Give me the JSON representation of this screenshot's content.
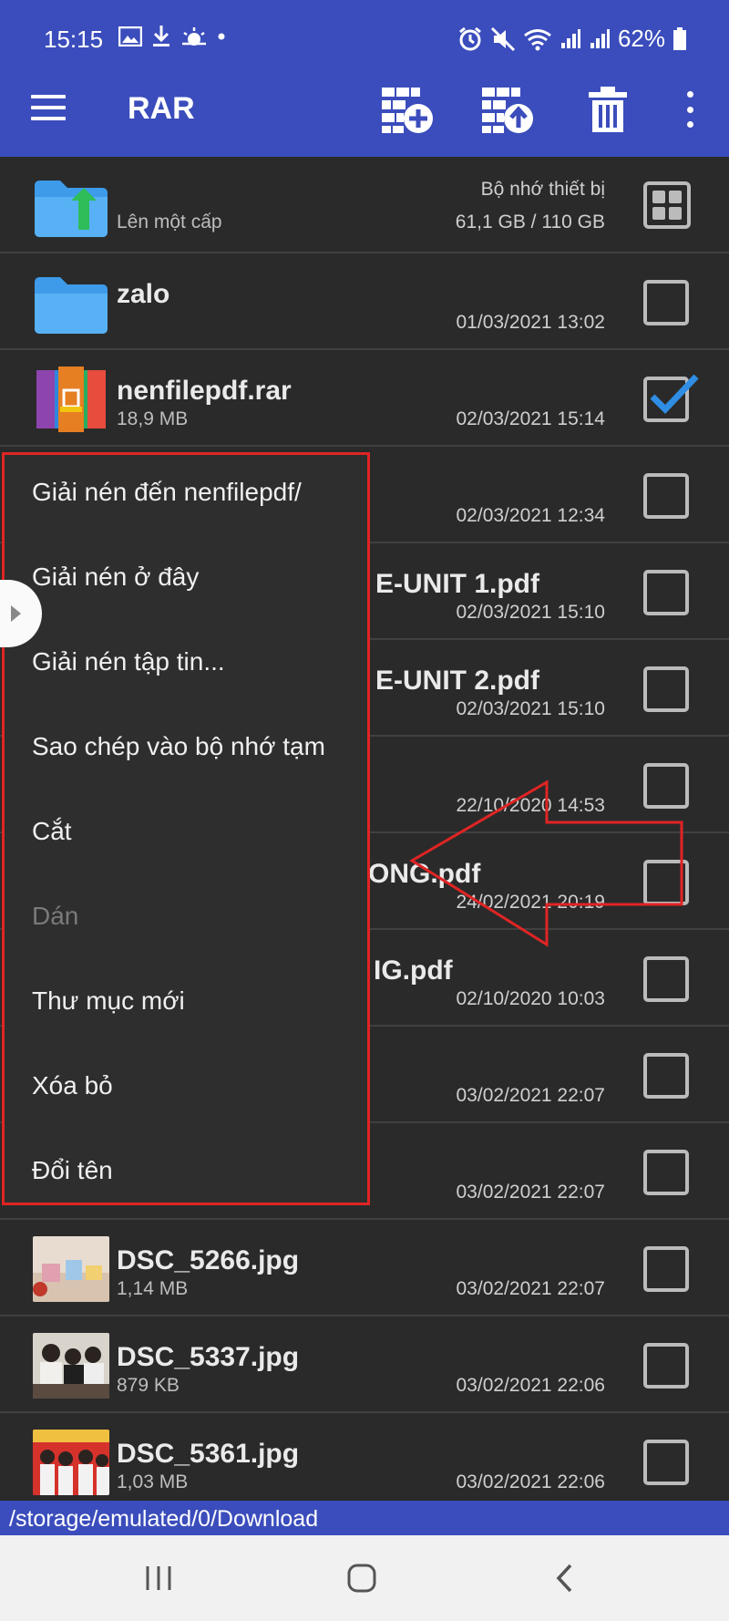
{
  "status_bar": {
    "time": "15:15",
    "left_icons": [
      "gallery-icon",
      "download-icon",
      "weather-icon",
      "dot-icon"
    ],
    "right_icons": [
      "alarm-icon",
      "mute-icon",
      "wifi-icon",
      "signal-icon",
      "signal-icon"
    ],
    "battery": "62%"
  },
  "toolbar": {
    "title": "RAR",
    "actions": [
      "add-to-archive-icon",
      "extract-archive-icon",
      "delete-icon",
      "overflow-menu-icon"
    ],
    "color": "#3b4dbc"
  },
  "file_list": {
    "up_row": {
      "label": "Lên một cấp",
      "storage_name": "Bộ nhớ thiết bị",
      "storage_usage": "61,1 GB / 110 GB"
    },
    "rows": [
      {
        "name": "zalo",
        "size": "",
        "date": "01/03/2021 13:02",
        "type": "folder",
        "checked": false
      },
      {
        "name": "nenfilepdf.rar",
        "size": "18,9 MB",
        "date": "02/03/2021 15:14",
        "type": "rar",
        "checked": true
      },
      {
        "name": "",
        "size": "",
        "date": "02/03/2021 12:34",
        "type": "hidden",
        "checked": false
      },
      {
        "name": "E-UNIT 1.pdf",
        "size": "",
        "date": "02/03/2021 15:10",
        "type": "hidden",
        "checked": false
      },
      {
        "name": "E-UNIT 2.pdf",
        "size": "",
        "date": "02/03/2021 15:10",
        "type": "hidden",
        "checked": false
      },
      {
        "name": "",
        "size": "",
        "date": "22/10/2020 14:53",
        "type": "hidden",
        "checked": false
      },
      {
        "name": "ONG.pdf",
        "size": "",
        "date": "24/02/2021 20:19",
        "type": "hidden",
        "checked": false
      },
      {
        "name": "IG.pdf",
        "size": "",
        "date": "02/10/2020 10:03",
        "type": "hidden",
        "checked": false
      },
      {
        "name": "",
        "size": "",
        "date": "03/02/2021 22:07",
        "type": "hidden",
        "checked": false
      },
      {
        "name": "",
        "size": "",
        "date": "03/02/2021 22:07",
        "type": "hidden",
        "checked": false
      },
      {
        "name": "DSC_5266.jpg",
        "size": "1,14 MB",
        "date": "03/02/2021 22:07",
        "type": "image",
        "checked": false
      },
      {
        "name": "DSC_5337.jpg",
        "size": "879 KB",
        "date": "03/02/2021 22:06",
        "type": "image",
        "checked": false
      },
      {
        "name": "DSC_5361.jpg",
        "size": "1,03 MB",
        "date": "03/02/2021 22:06",
        "type": "image",
        "checked": false
      }
    ]
  },
  "context_menu": {
    "items": [
      {
        "label": "Giải nén đến nenfilepdf/",
        "enabled": true
      },
      {
        "label": "Giải nén ở đây",
        "enabled": true
      },
      {
        "label": "Giải nén tập tin...",
        "enabled": true
      },
      {
        "label": "Sao chép vào bộ nhớ tạm",
        "enabled": true
      },
      {
        "label": "Cắt",
        "enabled": true
      },
      {
        "label": "Dán",
        "enabled": false
      },
      {
        "label": "Thư mục mới",
        "enabled": true
      },
      {
        "label": "Xóa bỏ",
        "enabled": true
      },
      {
        "label": "Đổi tên",
        "enabled": true
      }
    ],
    "highlight_color": "#e02424"
  },
  "path_bar": {
    "path": "/storage/emulated/0/Download"
  },
  "nav_bar": {
    "buttons": [
      "recents-icon",
      "home-icon",
      "back-icon"
    ]
  },
  "colors": {
    "accent": "#3b4dbc",
    "checkbox_check": "#2f8de4",
    "folder": "#3d9be9",
    "background": "#2a2a2a"
  }
}
